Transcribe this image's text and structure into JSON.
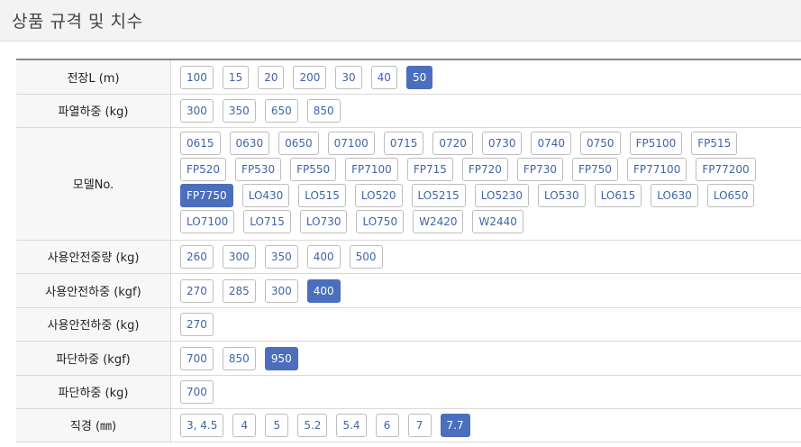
{
  "header": {
    "title": "상품 규격 및 치수"
  },
  "rows": [
    {
      "label": "전장L (m)",
      "options": [
        "100",
        "15",
        "20",
        "200",
        "30",
        "40",
        "50"
      ],
      "selected": "50"
    },
    {
      "label": "파열하중 (kg)",
      "options": [
        "300",
        "350",
        "650",
        "850"
      ],
      "selected": null
    },
    {
      "label": "모델No.",
      "options": [
        "0615",
        "0630",
        "0650",
        "07100",
        "0715",
        "0720",
        "0730",
        "0740",
        "0750",
        "FP5100",
        "FP515",
        "FP520",
        "FP530",
        "FP550",
        "FP7100",
        "FP715",
        "FP720",
        "FP730",
        "FP750",
        "FP77100",
        "FP77200",
        "FP7750",
        "LO430",
        "LO515",
        "LO520",
        "LO5215",
        "LO5230",
        "LO530",
        "LO615",
        "LO630",
        "LO650",
        "LO7100",
        "LO715",
        "LO730",
        "LO750",
        "W2420",
        "W2440"
      ],
      "selected": "FP7750"
    },
    {
      "label": "사용안전중량 (kg)",
      "options": [
        "260",
        "300",
        "350",
        "400",
        "500"
      ],
      "selected": null
    },
    {
      "label": "사용안전하중 (kgf)",
      "options": [
        "270",
        "285",
        "300",
        "400"
      ],
      "selected": "400"
    },
    {
      "label": "사용안전하중 (kg)",
      "options": [
        "270"
      ],
      "selected": null
    },
    {
      "label": "파단하중 (kgf)",
      "options": [
        "700",
        "850",
        "950"
      ],
      "selected": "950"
    },
    {
      "label": "파단하중 (kg)",
      "options": [
        "700"
      ],
      "selected": null
    },
    {
      "label": "직경 (㎜)",
      "options": [
        "3, 4.5",
        "4",
        "5",
        "5.2",
        "5.4",
        "6",
        "7",
        "7.7"
      ],
      "selected": "7.7"
    }
  ]
}
